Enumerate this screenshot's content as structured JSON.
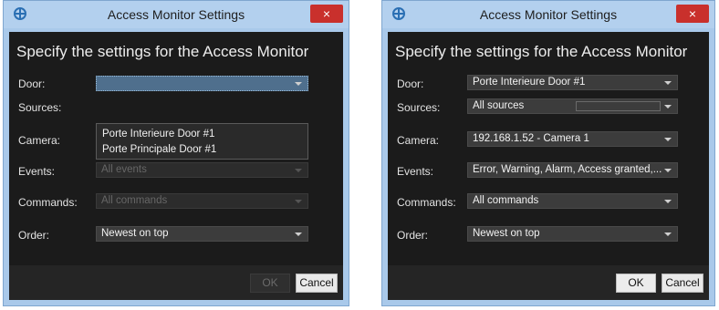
{
  "left_dialog": {
    "title": "Access Monitor Settings",
    "close_glyph": "×",
    "heading": "Specify the settings for the Access Monitor",
    "fields": {
      "door": {
        "label": "Door:",
        "value": ""
      },
      "sources": {
        "label": "Sources:"
      },
      "camera": {
        "label": "Camera:",
        "value": ""
      },
      "events": {
        "label": "Events:",
        "value": "All events"
      },
      "commands": {
        "label": "Commands:",
        "value": "All commands"
      },
      "order": {
        "label": "Order:",
        "value": "Newest on top"
      }
    },
    "door_dropdown_options": [
      "Porte Interieure Door #1",
      "Porte Principale Door #1"
    ],
    "ok_label": "OK",
    "cancel_label": "Cancel"
  },
  "right_dialog": {
    "title": "Access Monitor Settings",
    "close_glyph": "×",
    "heading": "Specify the settings for the Access Monitor",
    "fields": {
      "door": {
        "label": "Door:",
        "value": "Porte Interieure Door #1"
      },
      "sources": {
        "label": "Sources:",
        "value": "All sources"
      },
      "camera": {
        "label": "Camera:",
        "value": "192.168.1.52 - Camera 1"
      },
      "events": {
        "label": "Events:",
        "value": "Error, Warning, Alarm, Access granted,..."
      },
      "commands": {
        "label": "Commands:",
        "value": "All commands"
      },
      "order": {
        "label": "Order:",
        "value": "Newest on top"
      }
    },
    "ok_label": "OK",
    "cancel_label": "Cancel"
  },
  "colors": {
    "titlebar": "#b3d0ee",
    "dialog_body": "#1b1b1b",
    "close_button": "#c9302c",
    "focused_combo": "#4f6f8d"
  },
  "icons": {
    "app": "app-logo-icon",
    "close": "close-icon",
    "dropdown": "chevron-down-icon"
  }
}
